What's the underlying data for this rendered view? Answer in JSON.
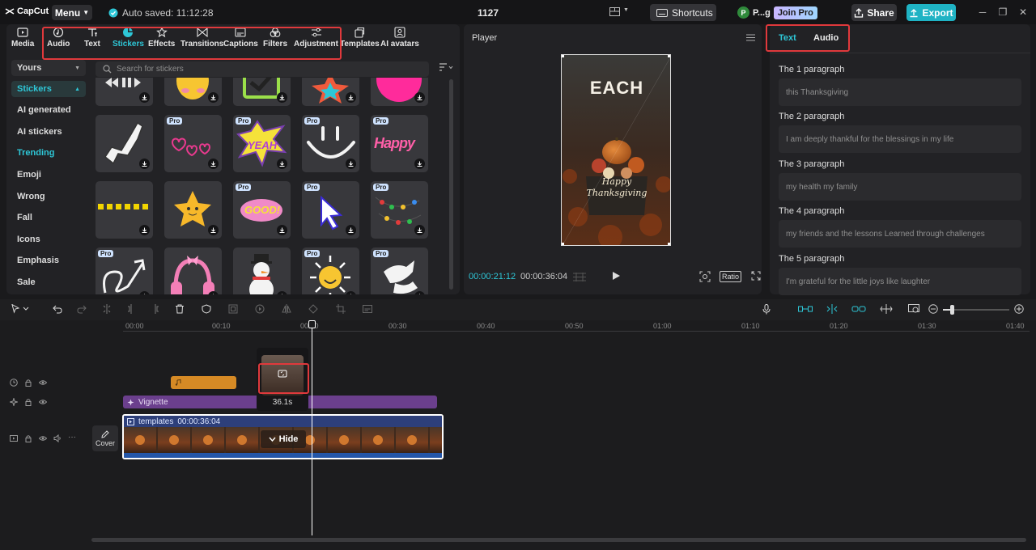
{
  "app": {
    "logo": "CapCut",
    "menu": "Menu",
    "autosave": "Auto saved: 11:12:28",
    "project": "1127"
  },
  "header": {
    "shortcuts": "Shortcuts",
    "user": "P...g",
    "join_pro": "Join Pro",
    "share": "Share",
    "export": "Export"
  },
  "toolbar": [
    {
      "label": "Media",
      "icon": "media-icon"
    },
    {
      "label": "Audio",
      "icon": "audio-icon"
    },
    {
      "label": "Text",
      "icon": "text-icon"
    },
    {
      "label": "Stickers",
      "icon": "stickers-icon",
      "active": true
    },
    {
      "label": "Effects",
      "icon": "effects-icon"
    },
    {
      "label": "Transitions",
      "icon": "transitions-icon"
    },
    {
      "label": "Captions",
      "icon": "captions-icon"
    },
    {
      "label": "Filters",
      "icon": "filters-icon"
    },
    {
      "label": "Adjustment",
      "icon": "adjustment-icon"
    },
    {
      "label": "Templates",
      "icon": "templates-icon"
    },
    {
      "label": "AI avatars",
      "icon": "ai-avatars-icon"
    }
  ],
  "sidenav": {
    "yours": "Yours",
    "stickers": "Stickers",
    "items": [
      "AI generated",
      "AI stickers",
      "Trending",
      "Emoji",
      "Wrong",
      "Fall",
      "Icons",
      "Emphasis",
      "Sale"
    ]
  },
  "search": {
    "placeholder": "Search for stickers"
  },
  "stickers": {
    "pro_badge": "Pro",
    "yeah_text": "YEAH",
    "happy_text": "Happy",
    "good_text": "GOOD!"
  },
  "player": {
    "title": "Player",
    "current_time": "00:00:21:12",
    "total_time": "00:00:36:04",
    "ratio": "Ratio",
    "preview_headline": "EACH",
    "preview_script_1": "Happy",
    "preview_script_2": "Thanksgiving"
  },
  "right_panel": {
    "tabs": [
      "Text",
      "Audio"
    ],
    "paragraphs": [
      {
        "label": "The 1 paragraph",
        "text": "this Thanksgiving"
      },
      {
        "label": "The 2 paragraph",
        "text": "I am deeply thankful for the blessings in my life"
      },
      {
        "label": "The 3 paragraph",
        "text": "my health my family"
      },
      {
        "label": "The 4 paragraph",
        "text": "my friends and the lessons Learned through challenges"
      },
      {
        "label": "The 5 paragraph",
        "text": "I'm grateful for the little joys like laughter"
      }
    ]
  },
  "timeline": {
    "ticks": [
      "00:00",
      "00:10",
      "00:20",
      "00:30",
      "00:40",
      "00:50",
      "01:00",
      "01:10",
      "01:20",
      "01:30",
      "01:40"
    ],
    "vignette_label": "Vignette",
    "clip_label": "templates",
    "clip_duration": "00:00:36:04",
    "hide_label": "Hide",
    "cover_label": "Cover",
    "popup_duration": "36.1s"
  },
  "colors": {
    "accent": "#2ec7d7",
    "highlight_box": "#e0393c",
    "vignette": "#6b3f8d",
    "audio_clip": "#d68a25",
    "clip_border": "#ffffff"
  }
}
